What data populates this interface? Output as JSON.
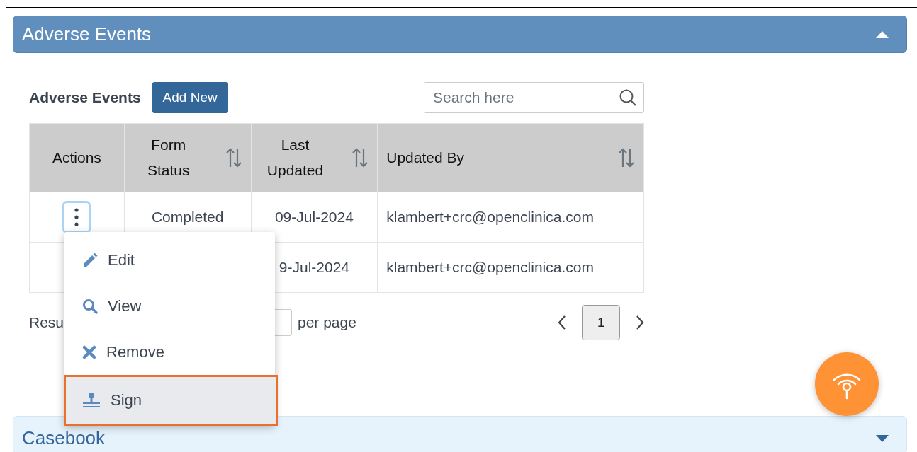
{
  "panel": {
    "title": "Adverse Events",
    "expanded": true
  },
  "toolbar": {
    "title": "Adverse Events",
    "add_button": "Add New",
    "search": {
      "placeholder": "Search here"
    }
  },
  "table": {
    "columns": [
      {
        "label": "Actions",
        "sortable": false
      },
      {
        "label": "Form Status",
        "sortable": true
      },
      {
        "label": "Last Updated",
        "sortable": true
      },
      {
        "label": "Updated By",
        "sortable": true
      }
    ],
    "rows": [
      {
        "actions_button": true,
        "cells": [
          "",
          "Completed",
          "09-Jul-2024",
          "klambert+crc@openclinica.com"
        ]
      },
      {
        "actions_button": false,
        "cells": [
          "",
          "",
          "9-Jul-2024",
          "klambert+crc@openclinica.com"
        ]
      }
    ]
  },
  "pagination": {
    "results_label": "Resu",
    "per_page_label": "per page",
    "pages": [
      {
        "label": "1",
        "selected": true
      }
    ]
  },
  "action_menu": {
    "items": [
      {
        "kind": "edit",
        "label": "Edit",
        "selected": false
      },
      {
        "kind": "view",
        "label": "View",
        "selected": false
      },
      {
        "kind": "remove",
        "label": "Remove",
        "selected": false
      },
      {
        "kind": "sign",
        "label": "Sign",
        "selected": true
      }
    ]
  },
  "casebook": {
    "title": "Casebook",
    "expanded": false
  }
}
